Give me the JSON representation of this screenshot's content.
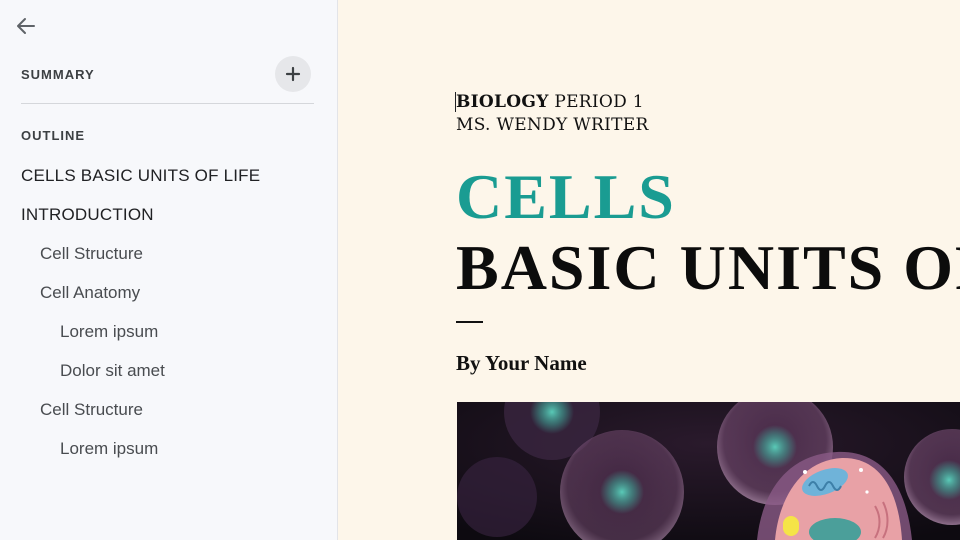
{
  "sidebar": {
    "summary_label": "SUMMARY",
    "outline_label": "OUTLINE",
    "items": [
      {
        "label": "CELLS BASIC UNITS OF LIFE",
        "level": 1
      },
      {
        "label": "INTRODUCTION",
        "level": 1
      },
      {
        "label": "Cell Structure",
        "level": 2
      },
      {
        "label": "Cell Anatomy",
        "level": 2
      },
      {
        "label": "Lorem ipsum",
        "level": 3
      },
      {
        "label": "Dolor sit amet",
        "level": 3
      },
      {
        "label": "Cell Structure",
        "level": 2
      },
      {
        "label": "Lorem ipsum",
        "level": 3
      }
    ]
  },
  "document": {
    "course_bold": "BIOLOGY",
    "course_rest": " PERIOD 1",
    "teacher": "MS. WENDY WRITER",
    "title_line1": "CELLS",
    "title_line2": "BASIC UNITS OF LIFE",
    "byline": "By Your Name"
  },
  "colors": {
    "accent": "#1a9c92",
    "page_background": "#fdf6ea",
    "sidebar_background": "#f7f8fb"
  }
}
